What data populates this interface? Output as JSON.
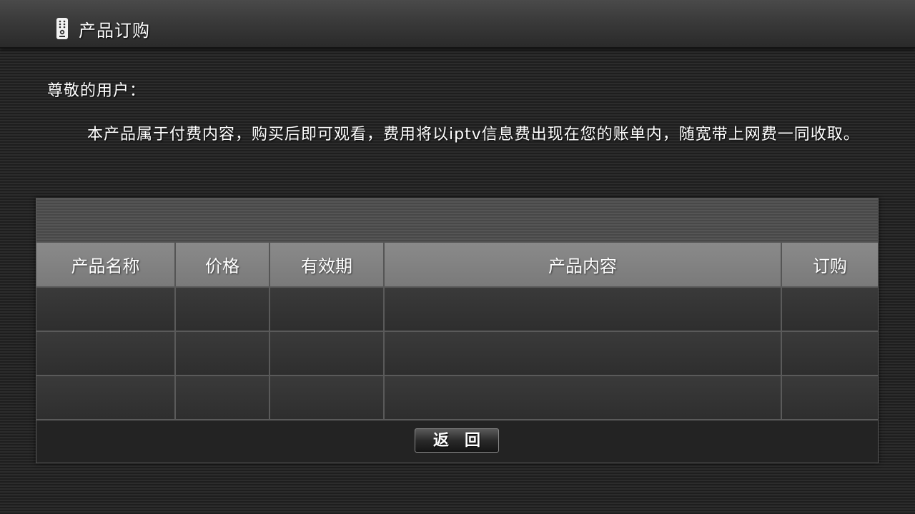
{
  "header": {
    "icon": "remote-control-icon",
    "title": "产品订购"
  },
  "message": {
    "greeting": "尊敬的用户：",
    "body": "本产品属于付费内容，购买后即可观看，费用将以iptv信息费出现在您的账单内，随宽带上网费一同收取。"
  },
  "table": {
    "columns": [
      "产品名称",
      "价格",
      "有效期",
      "产品内容",
      "订购"
    ],
    "rows": [
      [
        "",
        "",
        "",
        "",
        ""
      ],
      [
        "",
        "",
        "",
        "",
        ""
      ],
      [
        "",
        "",
        "",
        "",
        ""
      ]
    ]
  },
  "buttons": {
    "back_label": "返回"
  },
  "colors": {
    "background": "#262626",
    "header_bar": "#3a3a3a",
    "table_header": "#808080",
    "text": "#ffffff"
  }
}
